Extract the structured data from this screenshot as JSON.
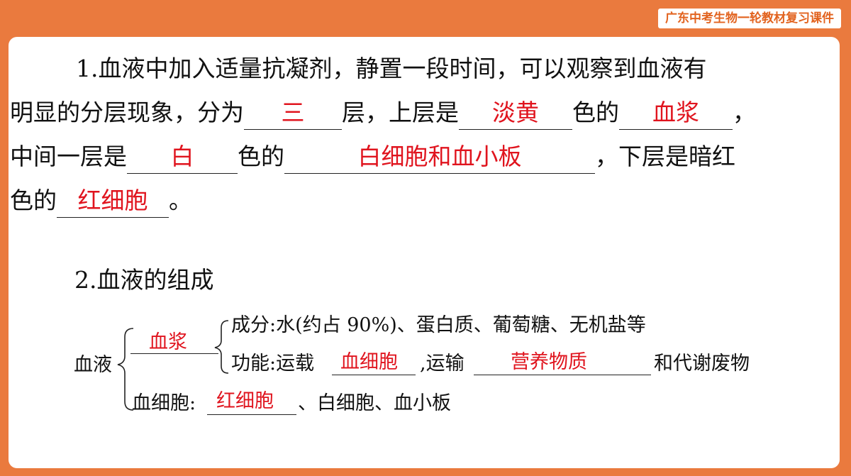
{
  "header": {
    "course_tag": "广东中考生物一轮教材复习课件"
  },
  "q1": {
    "line1": "1.血液中加入适量抗凝剂，静置一段时间，可以观察到血液有",
    "line2_a": "明显的分层现象，分为",
    "ans_layers": "三",
    "line2_b": "层，上层是",
    "ans_top_color": "淡黄",
    "line2_c": "色的",
    "ans_top": "血浆",
    "line2_d": "，",
    "line3_a": "中间一层是",
    "ans_mid_color": "白",
    "line3_b": "色的",
    "ans_mid": "白细胞和血小板",
    "line3_c": "，下层是暗红",
    "line4_a": "色的",
    "ans_bottom": "红细胞",
    "line4_b": "。"
  },
  "q2": {
    "title": "2.血液的组成",
    "root": "血液",
    "plasma_ans": "血浆",
    "components_label": "成分:水(约占 90%)、蛋白质、葡萄糖、无机盐等",
    "function_a": "功能:运载",
    "function_ans1": "血细胞",
    "function_b": ",运输",
    "function_ans2": "营养物质",
    "function_c": "和代谢废物",
    "cells_label": "血细胞:",
    "cells_ans": "红细胞",
    "cells_rest": "、白细胞、血小板"
  },
  "colors": {
    "frame": "#ea7a3e",
    "answer": "#e0141e",
    "tag_text": "#e2631f"
  }
}
